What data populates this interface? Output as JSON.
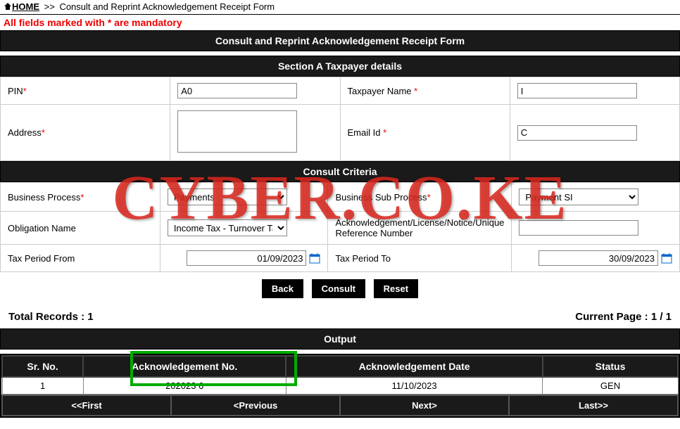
{
  "breadcrumb": {
    "home": "HOME",
    "sep": ">>",
    "current": "Consult and Reprint Acknowledgement Receipt Form"
  },
  "mandatory_note": "All fields marked with * are mandatory",
  "page_title": "Consult and Reprint Acknowledgement Receipt Form",
  "section_a": {
    "title": "Section A Taxpayer details",
    "pin_label": "PIN",
    "pin_value": "A0",
    "taxpayer_name_label": "Taxpayer Name ",
    "taxpayer_name_value": "I",
    "address_label": "Address",
    "address_value": "",
    "email_label": "Email Id ",
    "email_value": "C"
  },
  "consult": {
    "title": "Consult Criteria",
    "business_process_label": "Business Process",
    "business_process_value": "Payments",
    "business_sub_label": "Business Sub Process",
    "business_sub_value": "Payment SI",
    "obligation_label": "Obligation Name",
    "obligation_value": "Income Tax - Turnover Tax",
    "ack_ref_label": "Acknowledgement/License/Notice/Unique Reference Number",
    "ack_ref_value": "",
    "period_from_label": "Tax Period From",
    "period_from_value": "01/09/2023",
    "period_to_label": "Tax Period To",
    "period_to_value": "30/09/2023"
  },
  "buttons": {
    "back": "Back",
    "consult": "Consult",
    "reset": "Reset"
  },
  "records": {
    "total_label": "Total Records : ",
    "total_value": "1",
    "page_label": "Current Page : ",
    "page_value": "1 / 1"
  },
  "output": {
    "title": "Output",
    "headers": {
      "srno": "Sr. No.",
      "ackno": "Acknowledgement No.",
      "ackdate": "Acknowledgement Date",
      "status": "Status"
    },
    "rows": [
      {
        "srno": "1",
        "ackno": "202023            6",
        "ackdate": "11/10/2023",
        "status": "GEN"
      }
    ]
  },
  "nav": {
    "first": "<<First",
    "prev": "<Previous",
    "next": "Next>",
    "last": "Last>>"
  },
  "watermark": "CYBER.CO.KE"
}
